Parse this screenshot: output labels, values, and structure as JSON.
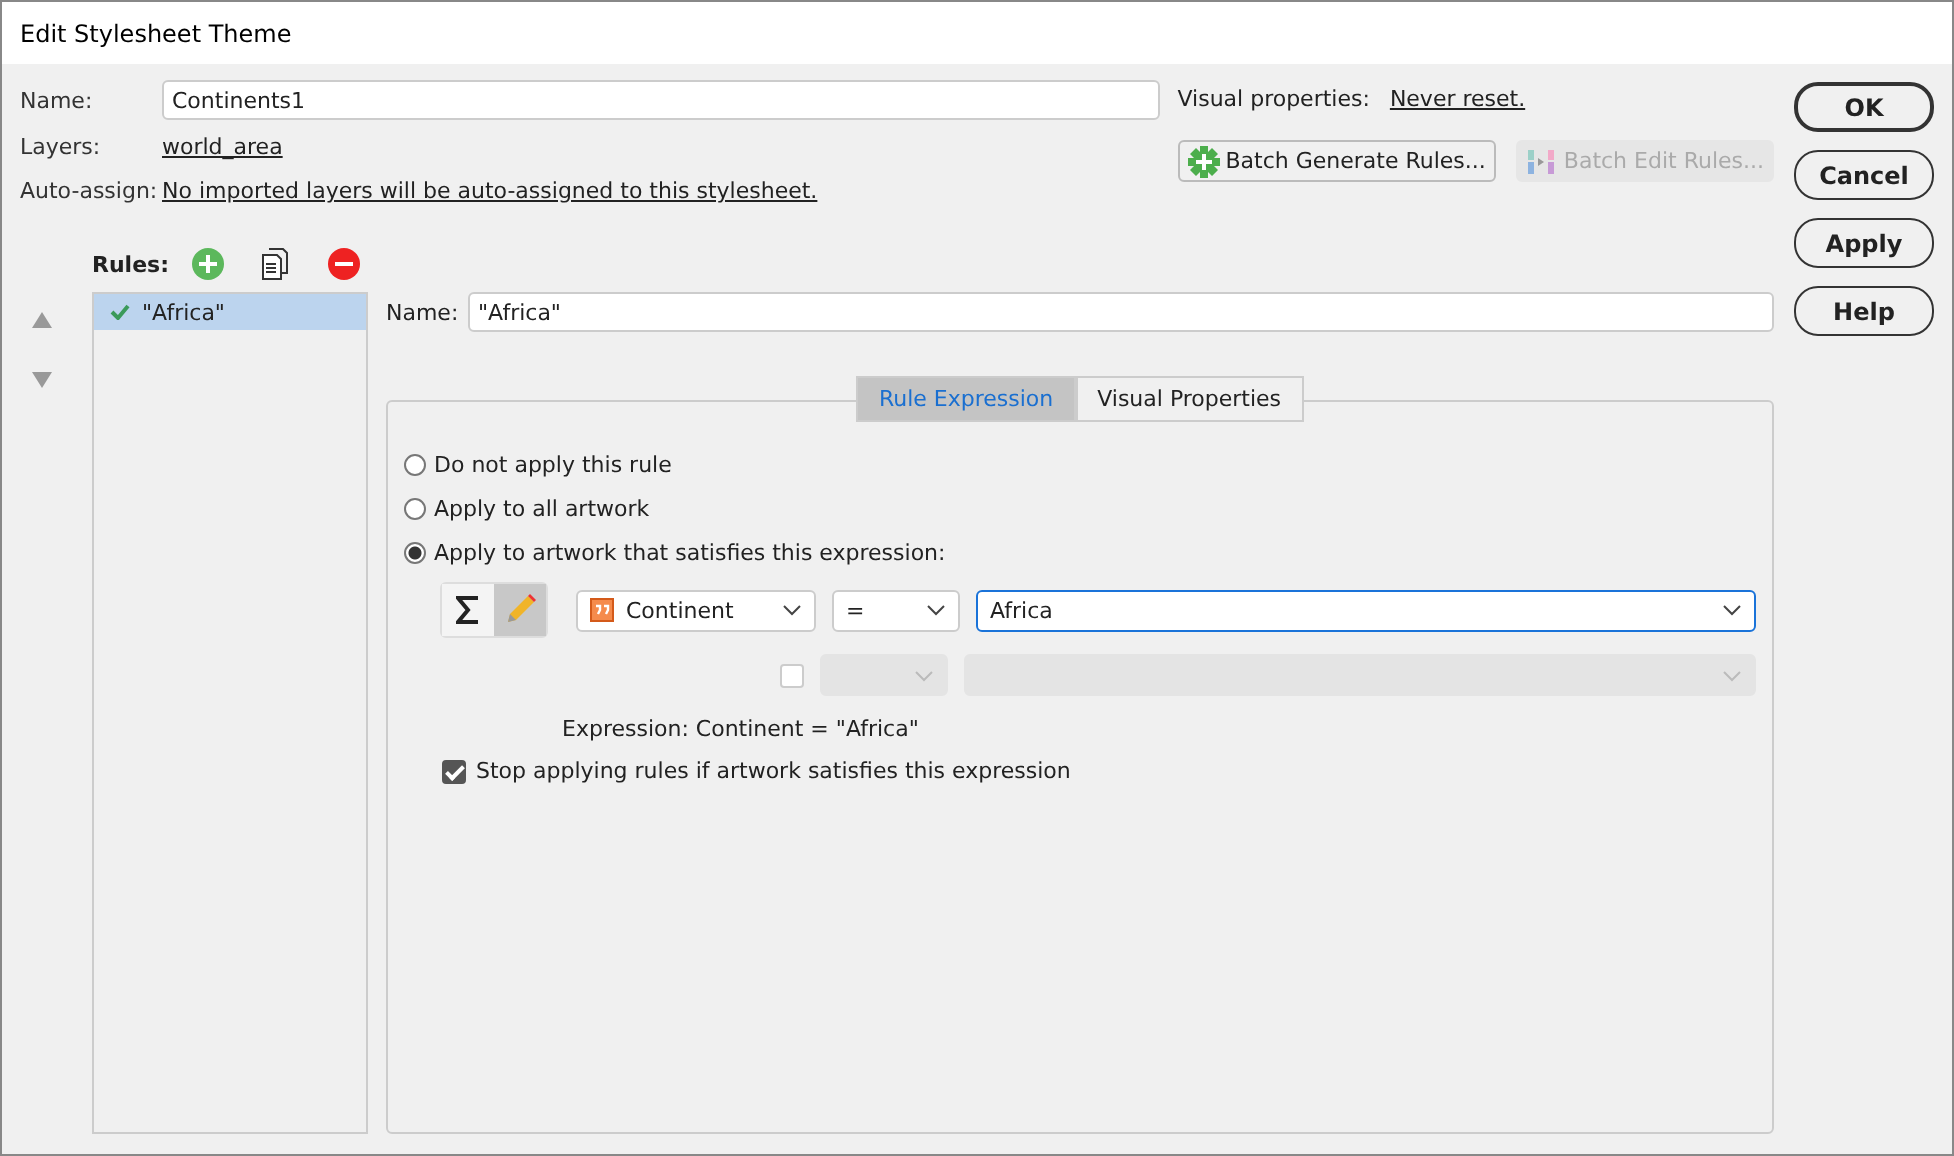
{
  "window": {
    "title": "Edit Stylesheet Theme"
  },
  "name_field": {
    "label": "Name:",
    "value": "Continents1"
  },
  "layers": {
    "label": "Layers:",
    "link": "world_area"
  },
  "auto_assign": {
    "label": "Auto-assign:",
    "link": "No imported layers will be auto-assigned to this stylesheet."
  },
  "visual_properties": {
    "label": "Visual properties:",
    "link": "Never reset."
  },
  "batch_buttons": [
    {
      "kind": "generate",
      "label": "Batch Generate Rules...",
      "disabled": false
    },
    {
      "kind": "edit",
      "label": "Batch Edit Rules...",
      "disabled": true
    }
  ],
  "dialog_buttons": [
    {
      "label": "OK",
      "default": true
    },
    {
      "label": "Cancel",
      "default": false
    },
    {
      "label": "Apply",
      "default": false
    },
    {
      "label": "Help",
      "default": false
    }
  ],
  "rules": {
    "label": "Rules:",
    "items": [
      {
        "label": "\"Africa\"",
        "selected": true,
        "enabled": true
      }
    ]
  },
  "rule_name": {
    "label": "Name:",
    "value": "\"Africa\""
  },
  "tabs": [
    {
      "label": "Rule Expression",
      "selected": true
    },
    {
      "label": "Visual Properties",
      "selected": false
    }
  ],
  "options": [
    {
      "label": "Do not apply this rule",
      "selected": false
    },
    {
      "label": "Apply to all artwork",
      "selected": false
    },
    {
      "label": "Apply to artwork that satisfies this expression:",
      "selected": true
    }
  ],
  "expression": {
    "mode_buttons": [
      {
        "kind": "sum",
        "selected": false
      },
      {
        "kind": "edit",
        "selected": true
      }
    ],
    "attribute": "Continent",
    "operator": "=",
    "value": "Africa"
  },
  "extra_condition": {
    "checked": false,
    "disabled": true
  },
  "expression_text": "Expression: Continent = \"Africa\"",
  "stop_rule": {
    "label": "Stop applying rules if artwork satisfies this expression",
    "checked": true
  }
}
